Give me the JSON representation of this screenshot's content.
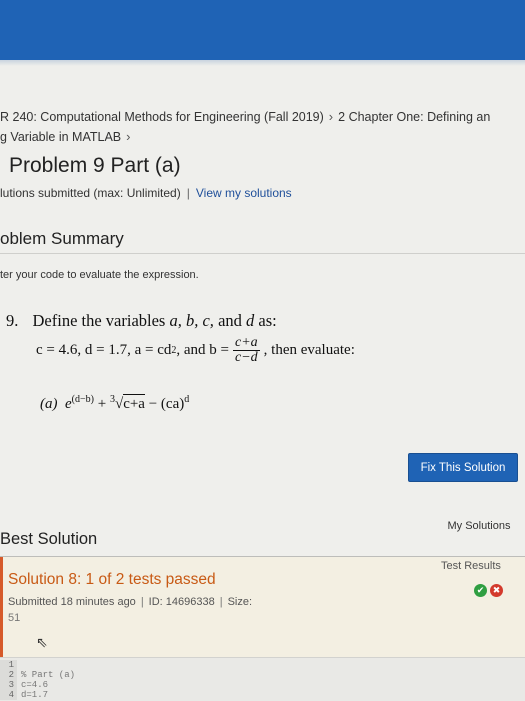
{
  "breadcrumb": {
    "course_row1": "R 240: Computational Methods for Engineering (Fall 2019)",
    "chapter": "2 Chapter One: Defining an",
    "course_row2": "g Variable in MATLAB"
  },
  "problem": {
    "title": "Problem 9 Part (a)",
    "submitted_text": "lutions submitted (max: Unlimited)",
    "view_link": "View my solutions"
  },
  "summary": {
    "heading": "oblem Summary",
    "instruction": "ter your code to evaluate the expression."
  },
  "statement": {
    "number": "9.",
    "define_text": "Define the variables",
    "vars": "a, b, c,",
    "and_word": "and",
    "last_var": "d",
    "as_word": "as:",
    "given_left": "c = 4.6, d = 1.7,  a = cd",
    "given_exp": "2",
    "and_b": ", and b =",
    "frac_num": "c+a",
    "frac_den": "c−d",
    "then": ", then evaluate:",
    "part_label": "(a)",
    "expr_base": "e",
    "expr_exp": "(d−b)",
    "expr_plus": "+",
    "root_index": "3",
    "root_content": "c+a",
    "expr_minus": "− (ca)",
    "expr_pow": "d"
  },
  "buttons": {
    "fix_solution": "Fix This Solution"
  },
  "best_solution": {
    "heading": "Best Solution",
    "my_solutions": "My Solutions"
  },
  "solution": {
    "title": "Solution 8: 1 of 2 tests passed",
    "test_results_label": "Test Results",
    "submitted": "Submitted 18 minutes ago",
    "id": "ID: 14696338",
    "size_label": "Size:",
    "size_value": "51"
  },
  "code": {
    "lines": [
      {
        "no": "1",
        "text": ""
      },
      {
        "no": "2",
        "text": "% Part (a)"
      },
      {
        "no": "3",
        "text": "c=4.6"
      },
      {
        "no": "4",
        "text": "d=1.7"
      }
    ]
  },
  "colors": {
    "header_blue": "#1f63b5",
    "solution_orange": "#c85a15",
    "pass_green": "#2e9e41",
    "fail_red": "#d33a2c"
  },
  "icons": {
    "pass": "check-circle-icon",
    "fail": "x-circle-icon",
    "cursor": "mouse-cursor-icon"
  }
}
